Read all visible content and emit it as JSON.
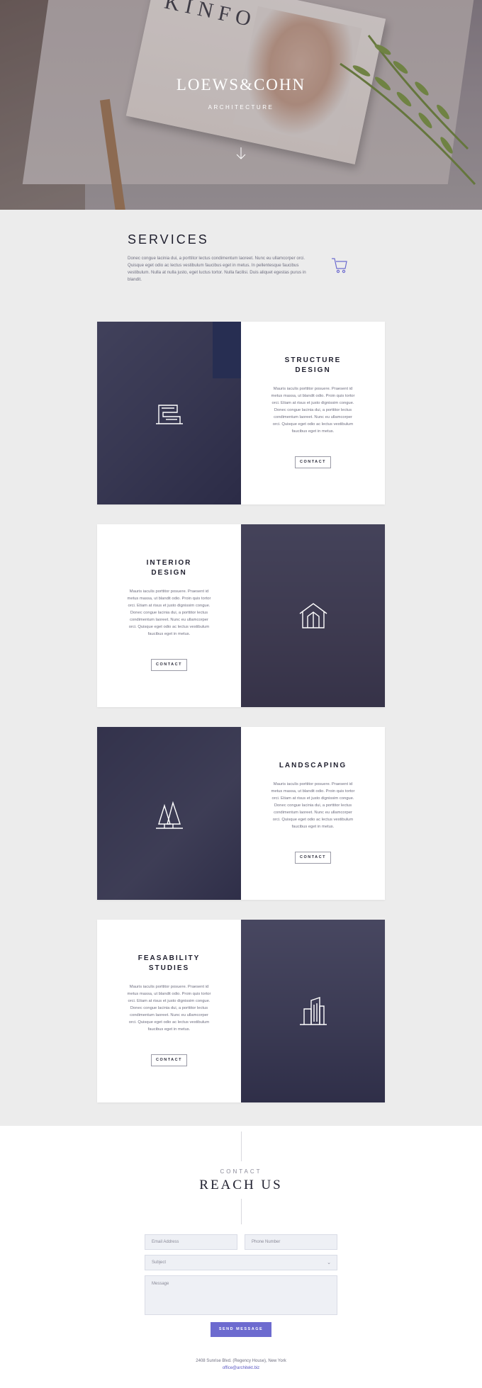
{
  "hero": {
    "brand": "LOEWS&COHN",
    "subtitle": "ARCHITECTURE",
    "magazine_title": "KINFOLK"
  },
  "services": {
    "title": "SERVICES",
    "intro": "Donec congue lacinia dui, a porttitor lectus condimentum laoreet. Nunc eu ullamcorper orci. Quisque eget odio ac lectus vestibulum faucibus eget in metus. In pellentesque faucibus vestibulum. Nulla at nulla justo, eget luctus tortor. Nulla facilisi. Duis aliquet egestas purus in blandit.",
    "cart_icon": "cart-icon",
    "cards": [
      {
        "title_line1": "STRUCTURE",
        "title_line2": "DESIGN",
        "body": "Mauris iaculis porttitor posuere. Praesent id metus massa, ut blandit odio. Proin quis tortor orci. Etiam at risus et justo dignissim congue. Donec congue lacinia dui, a porttitor lectus condimentum laoreet. Nunc eu ullamcorper orci. Quisque eget odio ac lectus vestibulum faucibus eget in metus.",
        "button": "CONTACT",
        "icon": "building-structure-icon"
      },
      {
        "title_line1": "INTERIOR",
        "title_line2": "DESIGN",
        "body": "Mauris iaculis porttitor posuere. Praesent id metus massa, ut blandit odio. Proin quis tortor orci. Etiam at risus et justo dignissim congue. Donec congue lacinia dui, a porttitor lectus condimentum laoreet. Nunc eu ullamcorper orci. Quisque eget odio ac lectus vestibulum faucibus eget in metus.",
        "button": "CONTACT",
        "icon": "house-interior-icon"
      },
      {
        "title_line1": "LANDSCAPING",
        "title_line2": "",
        "body": "Mauris iaculis porttitor posuere. Praesent id metus massa, ut blandit odio. Proin quis tortor orci. Etiam at risus et justo dignissim congue. Donec congue lacinia dui, a porttitor lectus condimentum laoreet. Nunc eu ullamcorper orci. Quisque eget odio ac lectus vestibulum faucibus eget in metus.",
        "button": "CONTACT",
        "icon": "trees-icon"
      },
      {
        "title_line1": "FEASABILITY",
        "title_line2": "STUDIES",
        "body": "Mauris iaculis porttitor posuere. Praesent id metus massa, ut blandit odio. Proin quis tortor orci. Etiam at risus et justo dignissim congue. Donec congue lacinia dui, a porttitor lectus condimentum laoreet. Nunc eu ullamcorper orci. Quisque eget odio ac lectus vestibulum faucibus eget in metus.",
        "button": "CONTACT",
        "icon": "skyscraper-icon"
      }
    ]
  },
  "contact": {
    "eyebrow": "CONTACT",
    "heading": "REACH US",
    "email_placeholder": "Email Address",
    "phone_placeholder": "Phone Number",
    "subject_placeholder": "Subject",
    "message_placeholder": "Message",
    "send_button": "SEND MESSAGE",
    "address": "2408 Sunrise Blvd. (Regency House), New York",
    "email": "office@architekt.biz"
  },
  "colors": {
    "accent": "#6d6bcf",
    "card_tint": "#28284a",
    "section_bg": "#ececec"
  }
}
